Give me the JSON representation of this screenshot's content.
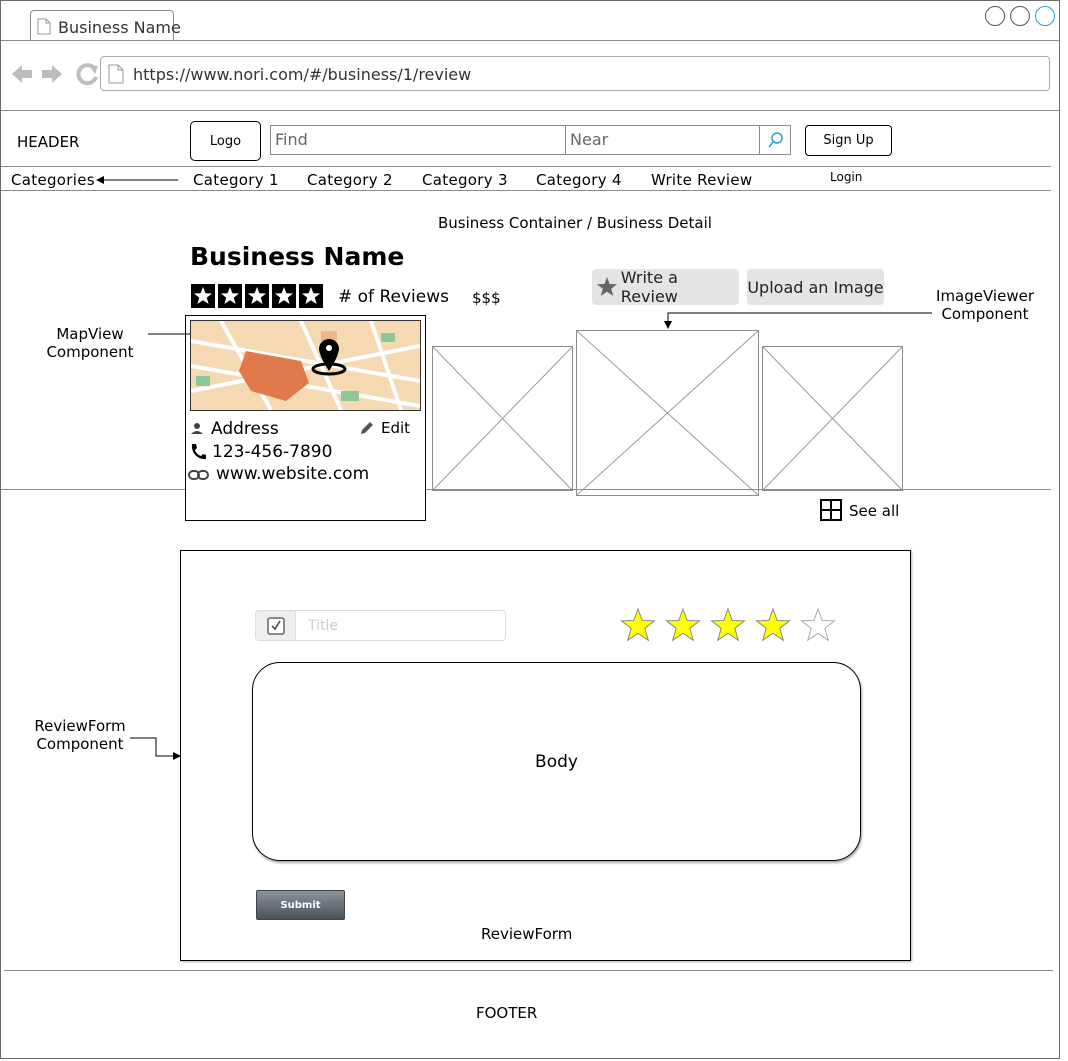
{
  "browser": {
    "tab_title": "Business Name",
    "url": "https://www.nori.com/#/business/1/review"
  },
  "header": {
    "label": "HEADER",
    "logo": "Logo",
    "find_placeholder": "Find",
    "near_placeholder": "Near",
    "signup": "Sign Up",
    "login": "Login"
  },
  "nav": {
    "categories": "Categories",
    "items": [
      "Category 1",
      "Category 2",
      "Category 3",
      "Category 4",
      "Write Review"
    ]
  },
  "business": {
    "container_label": "Business Container / Business Detail",
    "name": "Business Name",
    "stars": 5,
    "reviews": "# of Reviews",
    "price": "$$$",
    "write_review": "Write a Review",
    "upload_image": "Upload an Image",
    "address": "Address",
    "edit": "Edit",
    "phone": "123-456-7890",
    "website": "www.website.com",
    "see_all": "See all"
  },
  "annotations": {
    "mapview": "MapView\nComponent",
    "imageviewer": "ImageViewer\nComponent",
    "reviewform": "ReviewForm\nComponent"
  },
  "review_form": {
    "title_placeholder": "Title",
    "rating": 4,
    "rating_max": 5,
    "body": "Body",
    "submit": "Submit",
    "caption": "ReviewForm"
  },
  "footer": {
    "label": "FOOTER"
  },
  "colors": {
    "star_fill": "#ffff00",
    "accent": "#2a9fd6"
  }
}
